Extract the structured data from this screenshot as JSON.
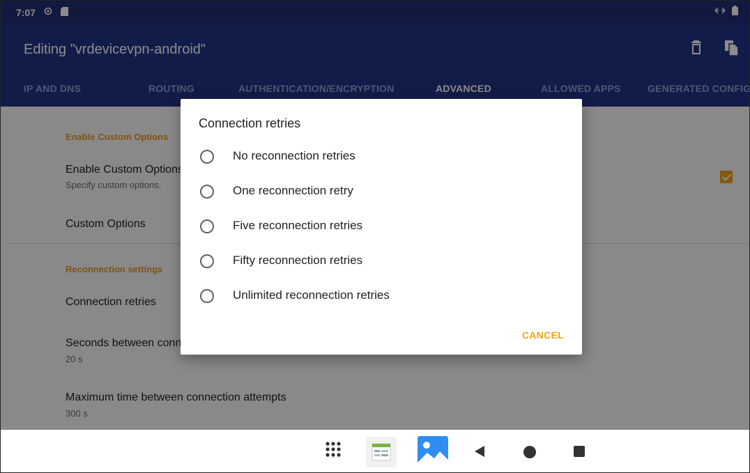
{
  "status": {
    "time": "7:07",
    "icons": [
      "sync-icon",
      "sd-card-icon",
      "vpn-arrows-icon",
      "battery-icon"
    ]
  },
  "appbar": {
    "title": "Editing \"vrdevicevpn-android\"",
    "actions": [
      "delete-icon",
      "copy-icon"
    ]
  },
  "tabs": [
    {
      "label": "IP AND DNS"
    },
    {
      "label": "ROUTING"
    },
    {
      "label": "AUTHENTICATION/ENCRYPTION"
    },
    {
      "label": "ADVANCED",
      "active": true
    },
    {
      "label": "ALLOWED APPS"
    },
    {
      "label": "GENERATED CONFIG"
    }
  ],
  "settings": {
    "custom_header": "Enable Custom Options",
    "custom_title": "Enable Custom Options",
    "custom_summary": "Specify custom options.",
    "custom_enabled": true,
    "custom_options_title": "Custom Options",
    "reconnection_header": "Reconnection settings",
    "connection_retries_title": "Connection retries",
    "seconds_between_title": "Seconds between connection attempts",
    "seconds_between_value": "20 s",
    "max_time_title": "Maximum time between connection attempts",
    "max_time_value": "300 s"
  },
  "dialog": {
    "title": "Connection retries",
    "options": [
      "No reconnection retries",
      "One reconnection retry",
      "Five reconnection retries",
      "Fifty reconnection retries",
      "Unlimited reconnection retries"
    ],
    "cancel_label": "CANCEL"
  },
  "navbar": {
    "items": [
      "app-drawer-icon",
      "sheets-app-icon",
      "gallery-app-icon",
      "back-icon",
      "home-icon",
      "recents-icon"
    ]
  },
  "colors": {
    "primary": "#223385",
    "status_bar": "#1f2f73",
    "accent": "#f2a31b"
  }
}
